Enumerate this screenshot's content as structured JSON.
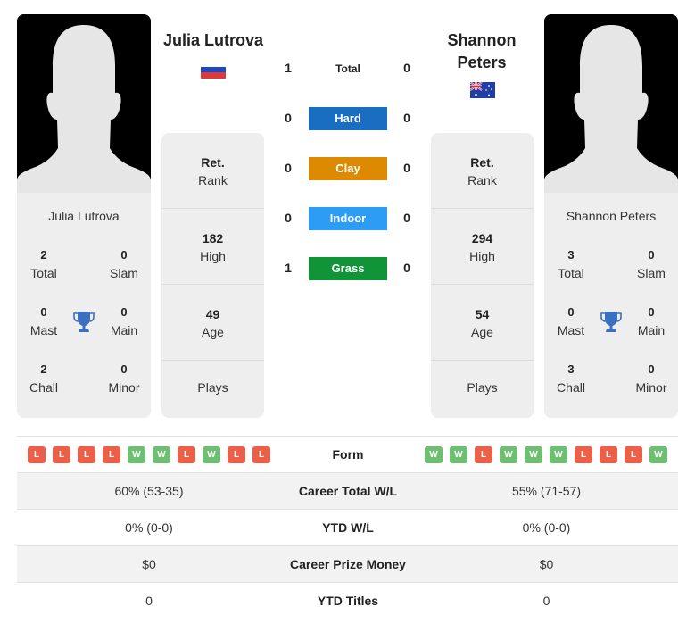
{
  "colors": {
    "hard": "#1a6ec2",
    "clay": "#dd8a00",
    "indoor": "#2d9cf4",
    "grass": "#119438",
    "win": "#6fbf73",
    "loss": "#ec5f48",
    "trophy": "#3b6fbf"
  },
  "player1": {
    "name": "Julia Lutrova",
    "flag": "russia-flag",
    "card_name": "Julia Lutrova",
    "titles": {
      "total": {
        "value": "2",
        "label": "Total"
      },
      "slam": {
        "value": "0",
        "label": "Slam"
      },
      "mast": {
        "value": "0",
        "label": "Mast"
      },
      "main": {
        "value": "0",
        "label": "Main"
      },
      "chall": {
        "value": "2",
        "label": "Chall"
      },
      "minor": {
        "value": "0",
        "label": "Minor"
      }
    },
    "info": {
      "rank": {
        "value": "Ret.",
        "label": "Rank"
      },
      "high": {
        "value": "182",
        "label": "High"
      },
      "age": {
        "value": "49",
        "label": "Age"
      },
      "plays": {
        "value": "",
        "label": "Plays"
      }
    },
    "form": [
      "L",
      "L",
      "L",
      "L",
      "W",
      "W",
      "L",
      "W",
      "L",
      "L"
    ]
  },
  "player2": {
    "name": "Shannon Peters",
    "flag": "australia-flag",
    "card_name": "Shannon Peters",
    "titles": {
      "total": {
        "value": "3",
        "label": "Total"
      },
      "slam": {
        "value": "0",
        "label": "Slam"
      },
      "mast": {
        "value": "0",
        "label": "Mast"
      },
      "main": {
        "value": "0",
        "label": "Main"
      },
      "chall": {
        "value": "3",
        "label": "Chall"
      },
      "minor": {
        "value": "0",
        "label": "Minor"
      }
    },
    "info": {
      "rank": {
        "value": "Ret.",
        "label": "Rank"
      },
      "high": {
        "value": "294",
        "label": "High"
      },
      "age": {
        "value": "54",
        "label": "Age"
      },
      "plays": {
        "value": "",
        "label": "Plays"
      }
    },
    "form": [
      "W",
      "W",
      "L",
      "W",
      "W",
      "W",
      "L",
      "L",
      "L",
      "W"
    ]
  },
  "h2h": [
    {
      "label": "Total",
      "p1": "1",
      "p2": "0"
    },
    {
      "label": "Hard",
      "p1": "0",
      "p2": "0"
    },
    {
      "label": "Clay",
      "p1": "0",
      "p2": "0"
    },
    {
      "label": "Indoor",
      "p1": "0",
      "p2": "0"
    },
    {
      "label": "Grass",
      "p1": "1",
      "p2": "0"
    }
  ],
  "comparison": {
    "form_label": "Form",
    "rows": [
      {
        "label": "Career Total W/L",
        "p1": "60% (53-35)",
        "p2": "55% (71-57)"
      },
      {
        "label": "YTD W/L",
        "p1": "0% (0-0)",
        "p2": "0% (0-0)"
      },
      {
        "label": "Career Prize Money",
        "p1": "$0",
        "p2": "$0"
      },
      {
        "label": "YTD Titles",
        "p1": "0",
        "p2": "0"
      }
    ]
  }
}
